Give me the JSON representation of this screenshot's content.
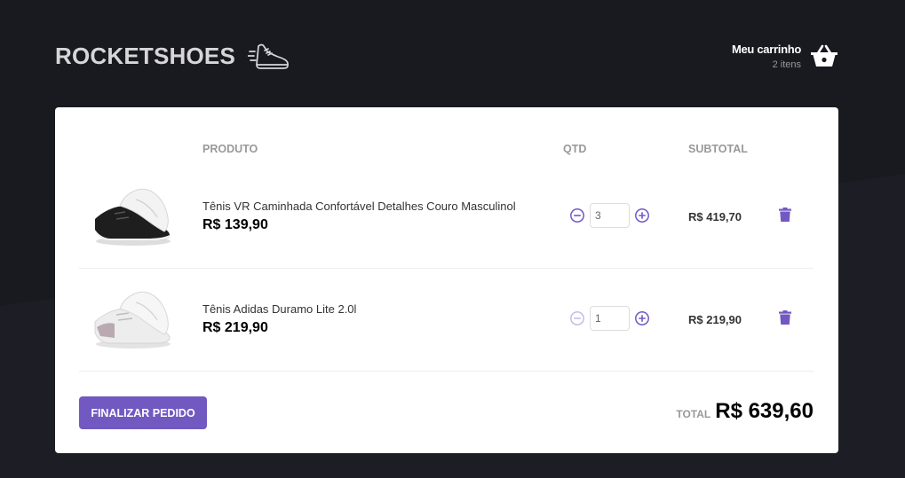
{
  "header": {
    "logo_text": "ROCKETSHOES",
    "cart_title": "Meu carrinho",
    "cart_count": "2 itens"
  },
  "table": {
    "headers": {
      "product": "PRODUTO",
      "qty": "QTD",
      "subtotal": "SUBTOTAL"
    },
    "items": [
      {
        "name": "Tênis VR Caminhada Confortável Detalhes Couro Masculinol",
        "price": "R$ 139,90",
        "quantity": "3",
        "subtotal": "R$ 419,70",
        "decrement_enabled": true,
        "image": "black-sneaker"
      },
      {
        "name": "Tênis Adidas Duramo Lite 2.0l",
        "price": "R$ 219,90",
        "quantity": "1",
        "subtotal": "R$ 219,90",
        "decrement_enabled": false,
        "image": "white-sneaker"
      }
    ]
  },
  "footer": {
    "finish_label": "FINALIZAR PEDIDO",
    "total_label": "TOTAL",
    "total_value": "R$ 639,60"
  },
  "colors": {
    "background": "#191920",
    "accent": "#7159c1",
    "panel": "#ffffff"
  },
  "icons": {
    "logo": "sneaker-icon",
    "cart": "basket-icon",
    "decrement": "minus-circle-icon",
    "increment": "plus-circle-icon",
    "delete": "trash-icon"
  }
}
